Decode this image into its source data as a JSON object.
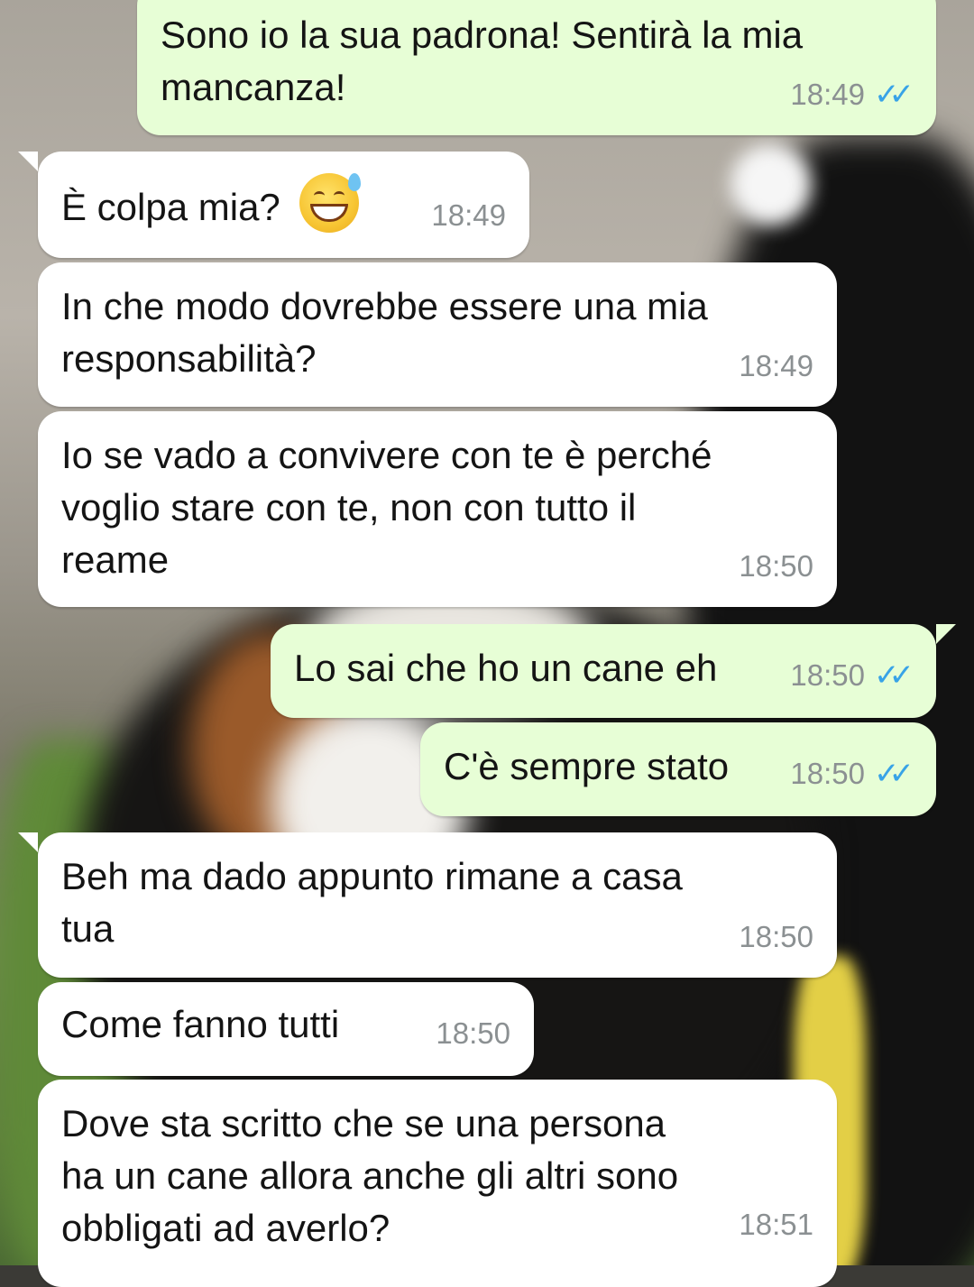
{
  "messages": [
    {
      "dir": "out",
      "text": "Sono io la sua padrona! Sentirà la mia\nmancanza!",
      "time": "18:49",
      "status": "read"
    },
    {
      "dir": "in",
      "text": "È colpa mia?",
      "emoji": "sweat-smile-emoji",
      "time": "18:49"
    },
    {
      "dir": "in",
      "text": "In che modo dovrebbe essere una mia\nresponsabilità?",
      "time": "18:49"
    },
    {
      "dir": "in",
      "text": "Io se vado a convivere con te è perché\nvoglio stare con te, non con tutto il\nreame",
      "time": "18:50"
    },
    {
      "dir": "out",
      "text": "Lo sai che ho un cane eh",
      "time": "18:50",
      "status": "read"
    },
    {
      "dir": "out",
      "text": "C'è sempre stato",
      "time": "18:50",
      "status": "read"
    },
    {
      "dir": "in",
      "text": "Beh ma dado appunto rimane a casa\ntua",
      "time": "18:50"
    },
    {
      "dir": "in",
      "text": "Come fanno tutti",
      "time": "18:50"
    },
    {
      "dir": "in",
      "text": "Dove sta scritto che se una persona\nha un cane allora anche gli altri sono\nobbligati ad averlo?",
      "time": "18:51"
    }
  ],
  "read_ticks": "✓✓",
  "colors": {
    "incoming": "#ffffff",
    "outgoing": "#e7fed6",
    "tick": "#38a3e7",
    "time": "#8b9092"
  }
}
